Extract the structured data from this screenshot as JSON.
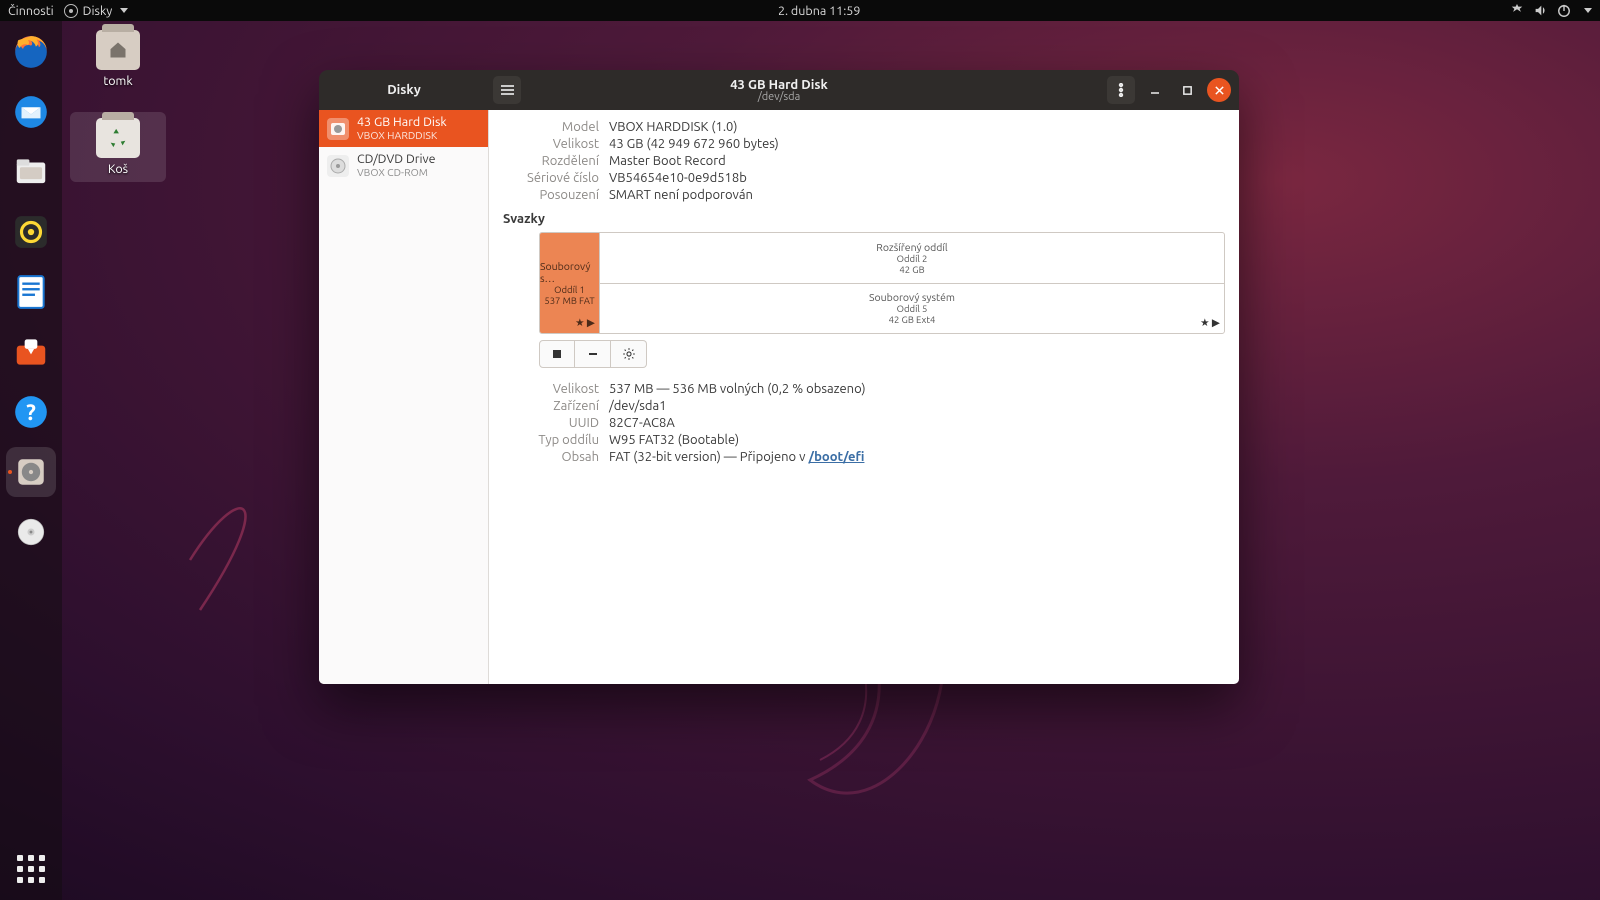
{
  "topbar": {
    "activities": "Činnosti",
    "app_name": "Disky",
    "clock": "2. dubna  11:59"
  },
  "desktop": {
    "home_label": "tomk",
    "trash_label": "Koš"
  },
  "window": {
    "sidebar_title": "Disky",
    "title": "43 GB Hard Disk",
    "subtitle": "/dev/sda"
  },
  "devices": [
    {
      "name": "43 GB Hard Disk",
      "sub": "VBOX HARDDISK",
      "selected": true
    },
    {
      "name": "CD/DVD Drive",
      "sub": "VBOX CD-ROM",
      "selected": false
    }
  ],
  "disk_props": {
    "model_k": "Model",
    "model_v": "VBOX HARDDISK (1.0)",
    "size_k": "Velikost",
    "size_v": "43 GB (42 949 672 960 bytes)",
    "part_k": "Rozdělení",
    "part_v": "Master Boot Record",
    "serial_k": "Sériové číslo",
    "serial_v": "VB54654e10-0e9d518b",
    "assess_k": "Posouzení",
    "assess_v": "SMART není podporován"
  },
  "volumes_header": "Svazky",
  "volumes": {
    "p1": {
      "l1": "Souborový s…",
      "l2": "Oddíl 1",
      "l3": "537 MB FAT"
    },
    "ext": {
      "l1": "Rozšířený oddíl",
      "l2": "Oddíl 2",
      "l3": "42 GB"
    },
    "fs": {
      "l1": "Souborový systém",
      "l2": "Oddíl 5",
      "l3": "42 GB Ext4"
    }
  },
  "vol_props": {
    "size_k": "Velikost",
    "size_v": "537 MB — 536 MB volných (0,2 % obsazeno)",
    "dev_k": "Zařízení",
    "dev_v": "/dev/sda1",
    "uuid_k": "UUID",
    "uuid_v": "82C7-AC8A",
    "ptype_k": "Typ oddílu",
    "ptype_v": "W95 FAT32 (Bootable)",
    "content_k": "Obsah",
    "content_v_prefix": "FAT (32-bit version) — Připojeno v ",
    "mount_path": "/boot/efi"
  }
}
